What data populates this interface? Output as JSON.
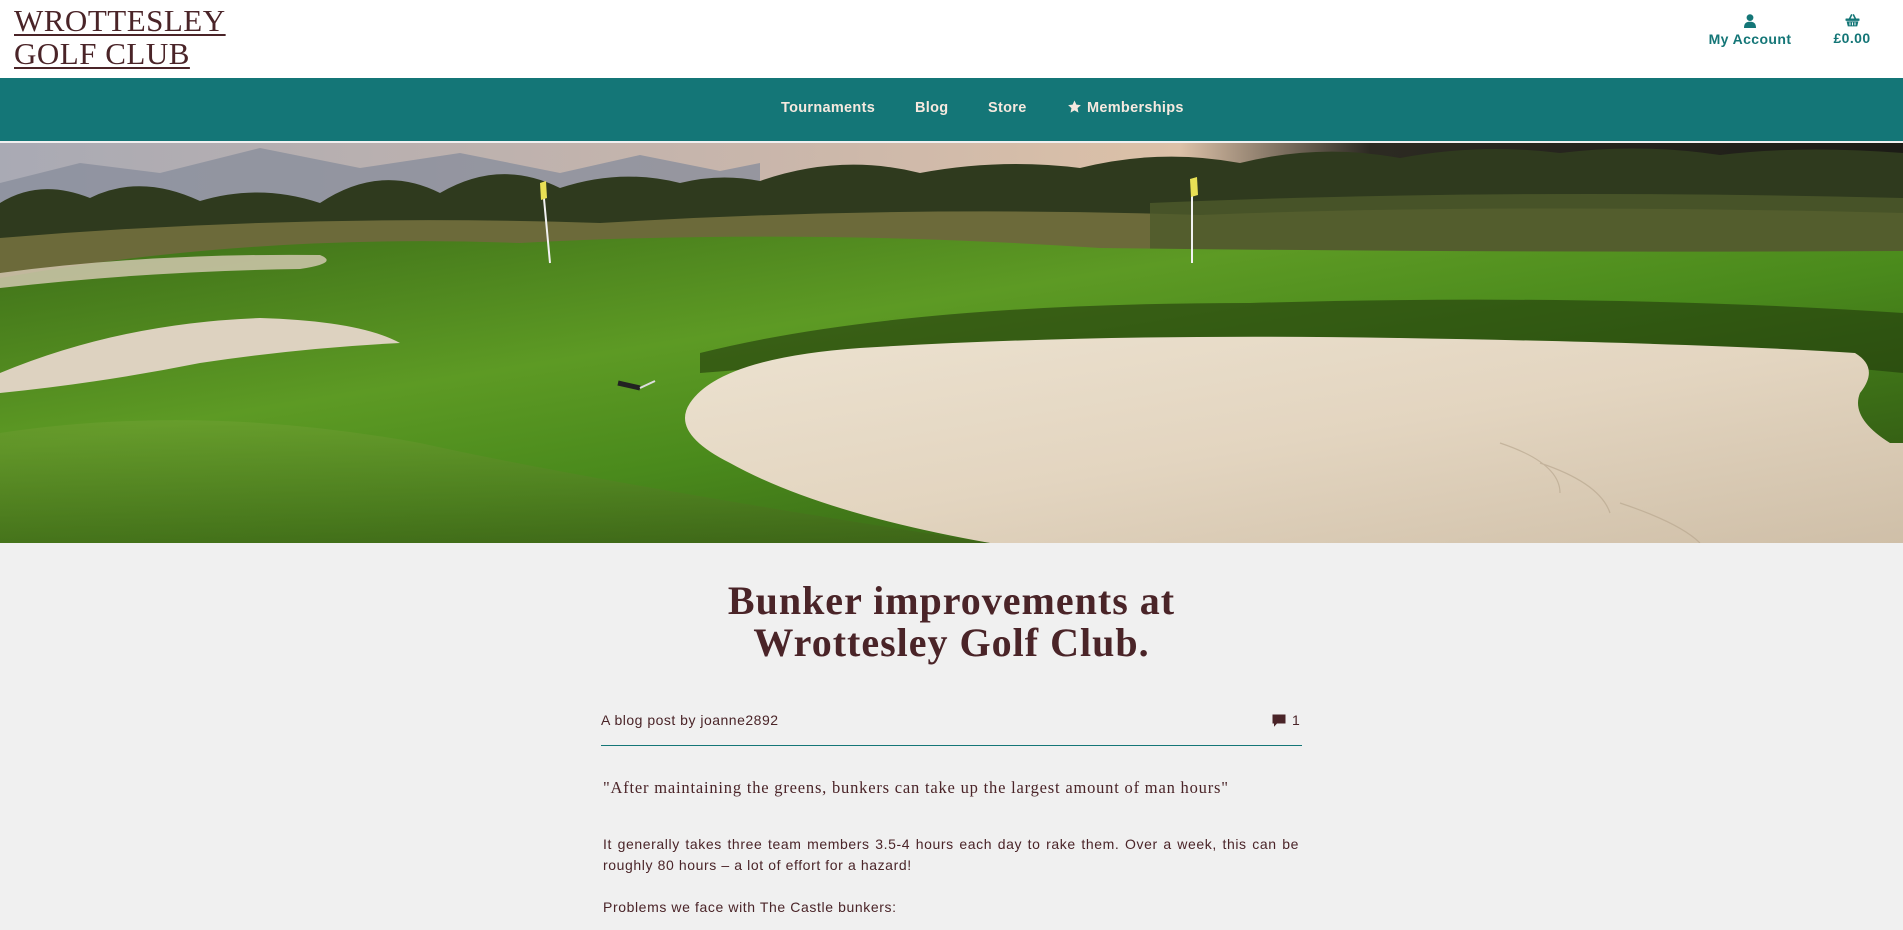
{
  "header": {
    "brand_line1": "WROTTESLEY",
    "brand_line2": "GOLF CLUB",
    "account_label": "My Account",
    "account_icon": "user-icon",
    "basket_total": "£0.00",
    "basket_icon": "shopping-basket-icon"
  },
  "nav": {
    "items": [
      {
        "label": "Tournaments"
      },
      {
        "label": "Blog"
      },
      {
        "label": "Store"
      },
      {
        "label": "Memberships",
        "icon": "star-icon"
      }
    ]
  },
  "hero": {
    "image": "golf-course-bunker-photo"
  },
  "post": {
    "title_line1": "Bunker improvements at",
    "title_line2": "Wrottesley Golf Club.",
    "byline": "A blog post by joanne2892",
    "comment_count": "1",
    "comment_icon": "comment-icon",
    "quote": "\"After maintaining the greens, bunkers can take up the largest amount of man hours\"",
    "paragraph1": "It generally takes three team members 3.5-4 hours each day to rake them. Over a week, this can be roughly 80 hours – a lot of effort for a hazard!",
    "paragraph2": "Problems we face with The Castle bunkers:"
  },
  "colors": {
    "brand": "#4a2428",
    "teal": "#147677",
    "nav_text": "#f6e9df",
    "page_bg": "#f0f0f0"
  }
}
